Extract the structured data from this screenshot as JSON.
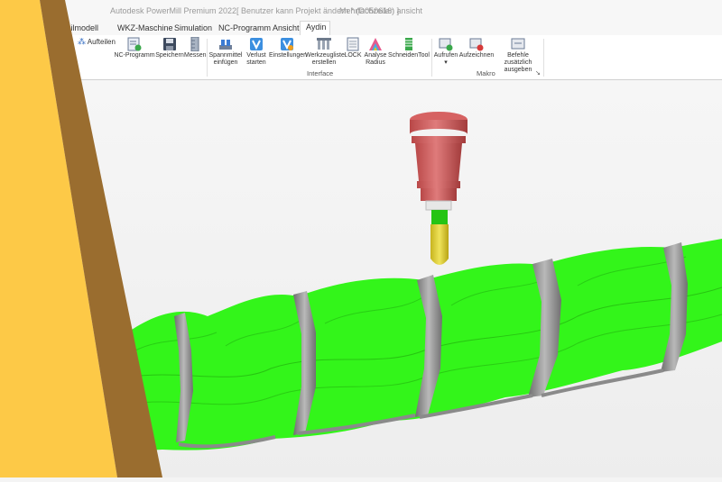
{
  "window": {
    "title_app": "Autodesk PowerMill Premium 2022",
    "title_project": "[ Benutzer kann Projekt ändern * (D050616) ]",
    "title_mode": "Mehrfachzeilen ansicht"
  },
  "tabs": [
    {
      "label": "hteilmodell"
    },
    {
      "label": "WKZ-Maschine"
    },
    {
      "label": "Simulation"
    },
    {
      "label": "NC-Programm"
    },
    {
      "label": "Ansicht"
    },
    {
      "label": "Aydin"
    }
  ],
  "ribbon": {
    "aufteilen": "Aufteilen",
    "nc_programm": "NC-Programm",
    "speichern": "Speichern",
    "messen": "Messen",
    "spannmittel_1": "Spannmittel",
    "spannmittel_2": "einfügen",
    "verlust_1": "Verlust",
    "verlust_2": "starten",
    "einstellungen": "Einstellungen",
    "werkzeugliste_1": "Werkzeugliste",
    "werkzeugliste_2": "erstellen",
    "lock": "LOCK",
    "analyse_1": "Analyse",
    "analyse_2": "Radius",
    "schneidentool": "SchneidenTool",
    "interface_group": "Interface",
    "aufrufen": "Aufrufen",
    "aufzeichnen": "Aufzeichnen",
    "befehle_1": "Befehle zusätzlich",
    "befehle_2": "ausgeben",
    "makro_group": "Makro",
    "launcher": "↘"
  },
  "colors": {
    "accent_yellow": "#fdc947",
    "stripe_brown": "#9a6d2f",
    "screw_green": "#33f51a",
    "collar_gray": "#8e8e8e",
    "holder_red": "#c95454",
    "tool_yellow": "#dccd28"
  },
  "icons": [
    "aufteilen-icon",
    "nc-programm-icon",
    "save-icon",
    "measure-icon",
    "fixture-icon",
    "verify-icon",
    "settings-icon",
    "toollist-icon",
    "lock-icon",
    "analysis-icon",
    "cutting-tool-icon",
    "macro-run-icon",
    "macro-record-icon",
    "macro-echo-icon"
  ]
}
